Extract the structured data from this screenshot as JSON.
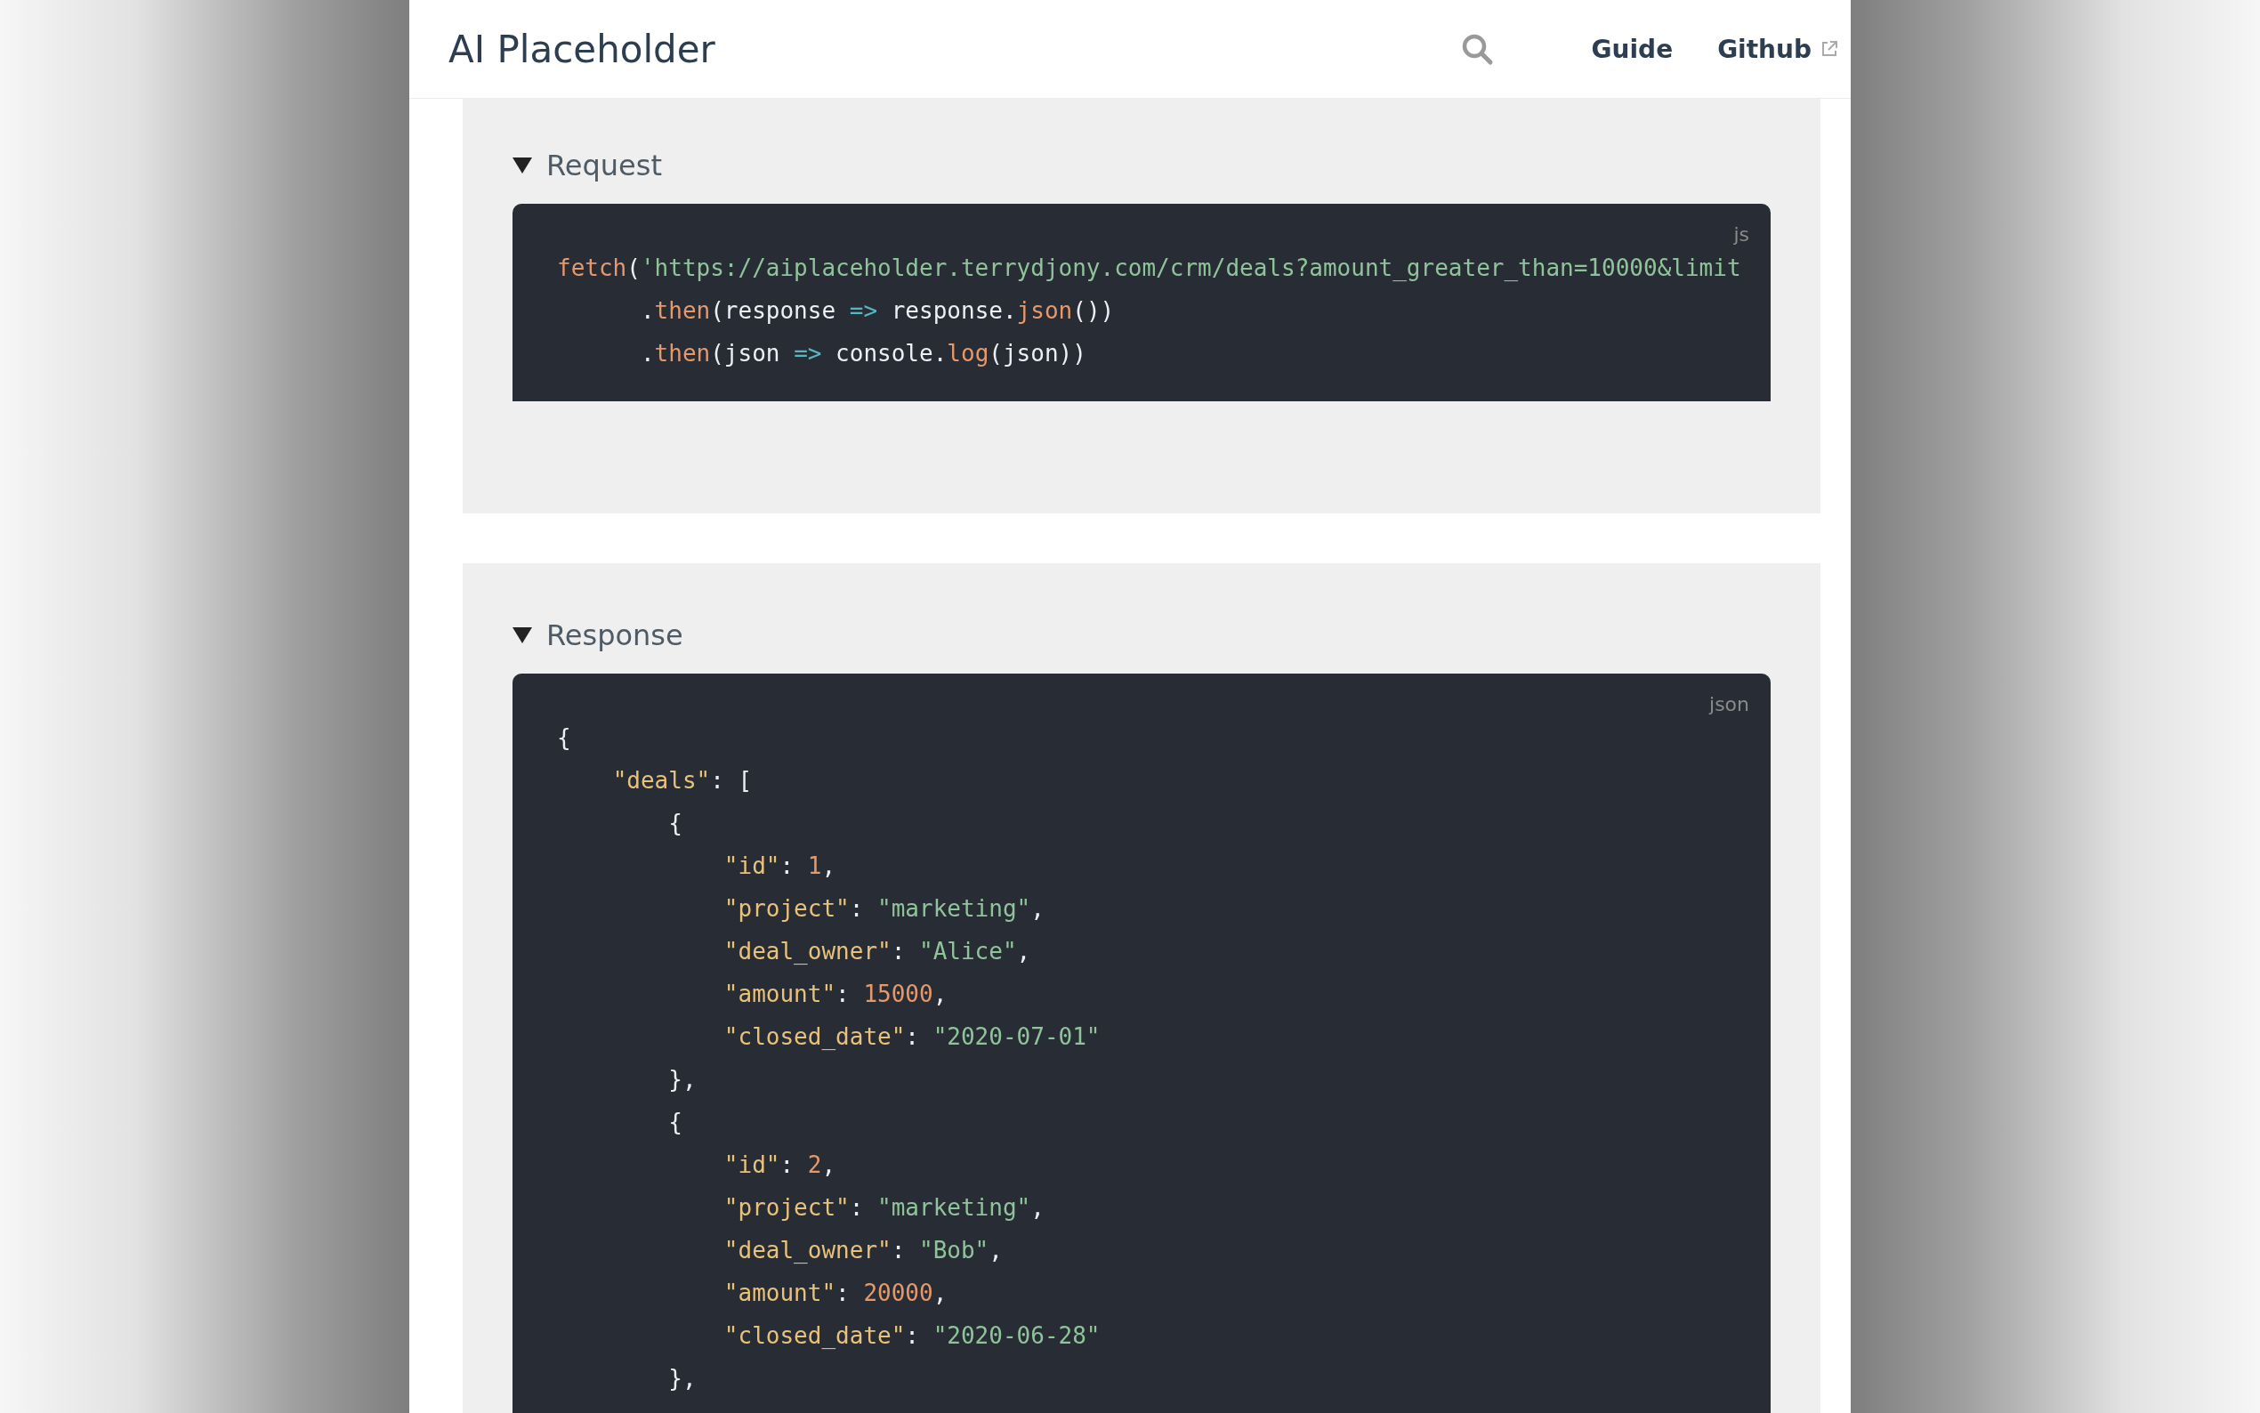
{
  "header": {
    "title": "AI Placeholder",
    "nav": [
      {
        "label": "Guide",
        "external": false
      },
      {
        "label": "Github",
        "external": true
      }
    ]
  },
  "sections": [
    {
      "summary": "Request",
      "expanded": true,
      "language": "js",
      "lines": [
        [
          {
            "kind": "fn",
            "text": "fetch"
          },
          {
            "kind": "plain",
            "text": "("
          },
          {
            "kind": "string",
            "text": "'https://aiplaceholder.terrydjony.com/crm/deals?amount_greater_than=10000&limit"
          }
        ],
        [
          {
            "kind": "plain",
            "text": "      ."
          },
          {
            "kind": "fn",
            "text": "then"
          },
          {
            "kind": "plain",
            "text": "(response "
          },
          {
            "kind": "op",
            "text": "=>"
          },
          {
            "kind": "plain",
            "text": " response."
          },
          {
            "kind": "fn",
            "text": "json"
          },
          {
            "kind": "plain",
            "text": "())"
          }
        ],
        [
          {
            "kind": "plain",
            "text": "      ."
          },
          {
            "kind": "fn",
            "text": "then"
          },
          {
            "kind": "plain",
            "text": "(json "
          },
          {
            "kind": "op",
            "text": "=>"
          },
          {
            "kind": "plain",
            "text": " console."
          },
          {
            "kind": "fn",
            "text": "log"
          },
          {
            "kind": "plain",
            "text": "(json))"
          }
        ]
      ]
    },
    {
      "summary": "Response",
      "expanded": true,
      "language": "json",
      "lines": [
        [
          {
            "kind": "plain",
            "text": "{"
          }
        ],
        [
          {
            "kind": "key",
            "text": "    \"deals\""
          },
          {
            "kind": "plain",
            "text": ": ["
          }
        ],
        [
          {
            "kind": "plain",
            "text": "        {"
          }
        ],
        [
          {
            "kind": "key",
            "text": "            \"id\""
          },
          {
            "kind": "plain",
            "text": ": "
          },
          {
            "kind": "number",
            "text": "1"
          },
          {
            "kind": "plain",
            "text": ","
          }
        ],
        [
          {
            "kind": "key",
            "text": "            \"project\""
          },
          {
            "kind": "plain",
            "text": ": "
          },
          {
            "kind": "string",
            "text": "\"marketing\""
          },
          {
            "kind": "plain",
            "text": ","
          }
        ],
        [
          {
            "kind": "key",
            "text": "            \"deal_owner\""
          },
          {
            "kind": "plain",
            "text": ": "
          },
          {
            "kind": "string",
            "text": "\"Alice\""
          },
          {
            "kind": "plain",
            "text": ","
          }
        ],
        [
          {
            "kind": "key",
            "text": "            \"amount\""
          },
          {
            "kind": "plain",
            "text": ": "
          },
          {
            "kind": "number",
            "text": "15000"
          },
          {
            "kind": "plain",
            "text": ","
          }
        ],
        [
          {
            "kind": "key",
            "text": "            \"closed_date\""
          },
          {
            "kind": "plain",
            "text": ": "
          },
          {
            "kind": "string",
            "text": "\"2020-07-01\""
          }
        ],
        [
          {
            "kind": "plain",
            "text": "        },"
          }
        ],
        [
          {
            "kind": "plain",
            "text": "        {"
          }
        ],
        [
          {
            "kind": "key",
            "text": "            \"id\""
          },
          {
            "kind": "plain",
            "text": ": "
          },
          {
            "kind": "number",
            "text": "2"
          },
          {
            "kind": "plain",
            "text": ","
          }
        ],
        [
          {
            "kind": "key",
            "text": "            \"project\""
          },
          {
            "kind": "plain",
            "text": ": "
          },
          {
            "kind": "string",
            "text": "\"marketing\""
          },
          {
            "kind": "plain",
            "text": ","
          }
        ],
        [
          {
            "kind": "key",
            "text": "            \"deal_owner\""
          },
          {
            "kind": "plain",
            "text": ": "
          },
          {
            "kind": "string",
            "text": "\"Bob\""
          },
          {
            "kind": "plain",
            "text": ","
          }
        ],
        [
          {
            "kind": "key",
            "text": "            \"amount\""
          },
          {
            "kind": "plain",
            "text": ": "
          },
          {
            "kind": "number",
            "text": "20000"
          },
          {
            "kind": "plain",
            "text": ","
          }
        ],
        [
          {
            "kind": "key",
            "text": "            \"closed_date\""
          },
          {
            "kind": "plain",
            "text": ": "
          },
          {
            "kind": "string",
            "text": "\"2020-06-28\""
          }
        ],
        [
          {
            "kind": "plain",
            "text": "        },"
          }
        ]
      ]
    }
  ]
}
